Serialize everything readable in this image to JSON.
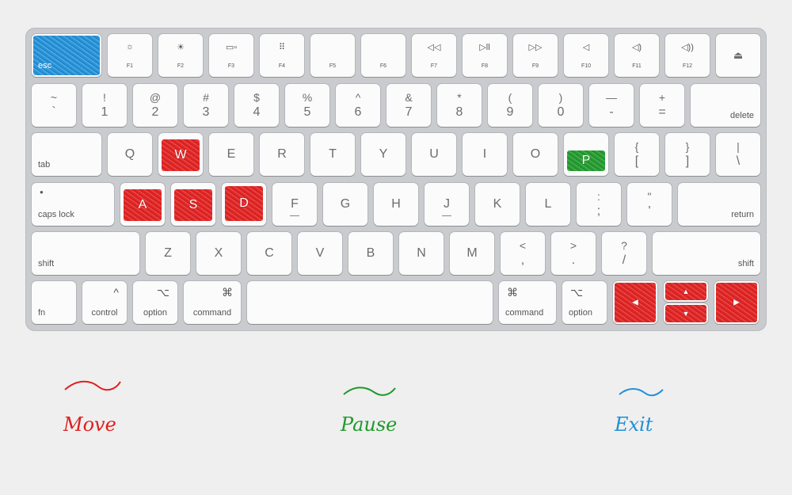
{
  "colors": {
    "move": "#e01e1e",
    "pause": "#1e9a2a",
    "exit": "#1e90d8"
  },
  "row0": {
    "esc": "esc",
    "f_keys": [
      {
        "label": "F1",
        "icon": "☼"
      },
      {
        "label": "F2",
        "icon": "☀"
      },
      {
        "label": "F3",
        "icon": "▭▫"
      },
      {
        "label": "F4",
        "icon": "⠿"
      },
      {
        "label": "F5",
        "icon": ""
      },
      {
        "label": "F6",
        "icon": ""
      },
      {
        "label": "F7",
        "icon": "◁◁"
      },
      {
        "label": "F8",
        "icon": "▷ll"
      },
      {
        "label": "F9",
        "icon": "▷▷"
      },
      {
        "label": "F10",
        "icon": "◁"
      },
      {
        "label": "F11",
        "icon": "◁)"
      },
      {
        "label": "F12",
        "icon": "◁))"
      }
    ],
    "eject": "⏏"
  },
  "row1": {
    "keys": [
      {
        "top": "~",
        "bottom": "`"
      },
      {
        "top": "!",
        "bottom": "1"
      },
      {
        "top": "@",
        "bottom": "2"
      },
      {
        "top": "#",
        "bottom": "3"
      },
      {
        "top": "$",
        "bottom": "4"
      },
      {
        "top": "%",
        "bottom": "5"
      },
      {
        "top": "^",
        "bottom": "6"
      },
      {
        "top": "&",
        "bottom": "7"
      },
      {
        "top": "*",
        "bottom": "8"
      },
      {
        "top": "(",
        "bottom": "9"
      },
      {
        "top": ")",
        "bottom": "0"
      },
      {
        "top": "—",
        "bottom": "-"
      },
      {
        "top": "+",
        "bottom": "="
      }
    ],
    "delete": "delete"
  },
  "row2": {
    "tab": "tab",
    "letters": [
      "Q",
      "W",
      "E",
      "R",
      "T",
      "Y",
      "U",
      "I",
      "O",
      "P"
    ],
    "brace_open": {
      "top": "{",
      "bottom": "["
    },
    "brace_close": {
      "top": "}",
      "bottom": "]"
    },
    "pipe": {
      "top": "|",
      "bottom": "\\"
    }
  },
  "row3": {
    "caps": "caps lock",
    "letters": [
      "A",
      "S",
      "D",
      "F",
      "G",
      "H",
      "J",
      "K",
      "L"
    ],
    "semicolon": {
      "top": ":",
      "bottom": ";"
    },
    "quote": {
      "top": "\"",
      "bottom": "'"
    },
    "return": "return"
  },
  "row4": {
    "shift_left": "shift",
    "letters": [
      "Z",
      "X",
      "C",
      "V",
      "B",
      "N",
      "M"
    ],
    "comma": {
      "top": "<",
      "bottom": ","
    },
    "period": {
      "top": ">",
      "bottom": "."
    },
    "slash": {
      "top": "?",
      "bottom": "/"
    },
    "shift_right": "shift"
  },
  "row5": {
    "fn": "fn",
    "control": {
      "icon": "^",
      "label": "control"
    },
    "option_left": {
      "icon": "⌥",
      "label": "option"
    },
    "command_left": {
      "icon": "⌘",
      "label": "command"
    },
    "command_right": {
      "icon": "⌘",
      "label": "command"
    },
    "option_right": {
      "icon": "⌥",
      "label": "option"
    },
    "arrow_left": "◀",
    "arrow_up": "▲",
    "arrow_down": "▼",
    "arrow_right": "▶"
  },
  "legend": {
    "move": "Move",
    "pause": "Pause",
    "exit": "Exit"
  }
}
